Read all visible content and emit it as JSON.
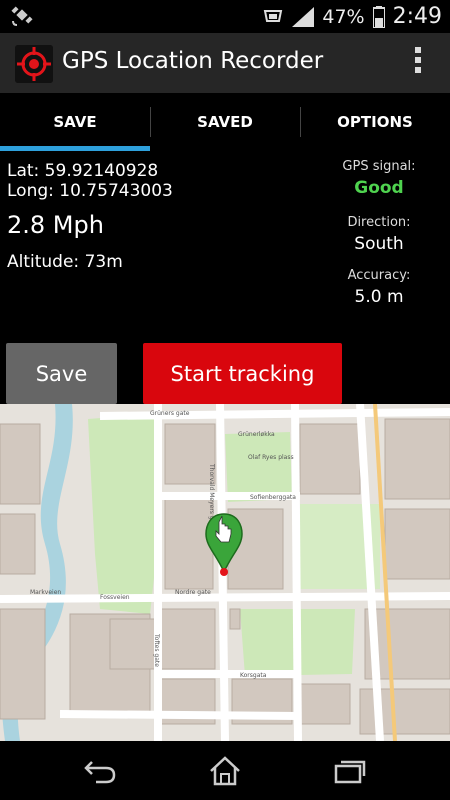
{
  "status_bar": {
    "left_icon": "satellite-icon",
    "battery_percent": "47%",
    "time": "2:49",
    "icons": [
      "notification-icon",
      "signal-icon",
      "battery-icon"
    ]
  },
  "app": {
    "title": "GPS Location Recorder",
    "icon": "crosshair-target-icon",
    "menu_icon": "overflow-menu-icon"
  },
  "tabs": [
    {
      "label": "SAVE",
      "active": true
    },
    {
      "label": "SAVED",
      "active": false
    },
    {
      "label": "OPTIONS",
      "active": false
    }
  ],
  "location": {
    "lat_text": "Lat: 59.92140928",
    "long_text": "Long: 10.75743003",
    "speed_text": "2.8 Mph",
    "altitude_text": "Altitude: 73m"
  },
  "details": {
    "gps_signal_label": "GPS signal:",
    "gps_signal_value": "Good",
    "direction_label": "Direction:",
    "direction_value": "South",
    "accuracy_label": "Accuracy:",
    "accuracy_value": "5.0 m"
  },
  "buttons": {
    "save_label": "Save",
    "start_tracking_label": "Start tracking"
  },
  "map": {
    "marker_icon": "hand-pointer-map-marker-icon",
    "street_labels": [
      "Grüners gate",
      "Grünerløkka",
      "Sofienberggata",
      "Nordre gate",
      "Markveien",
      "Thorvald Meyers gate",
      "Korsgata",
      "Toftes gate",
      "Fossveien",
      "Olaf Ryes plass"
    ]
  },
  "colors": {
    "accent_tab": "#2ea0dc",
    "start_tracking": "#d9060d",
    "gps_good": "#4fd34f",
    "marker": "#3aa53a"
  },
  "nav_bar": {
    "back": "back-icon",
    "home": "home-icon",
    "recents": "recents-icon"
  }
}
